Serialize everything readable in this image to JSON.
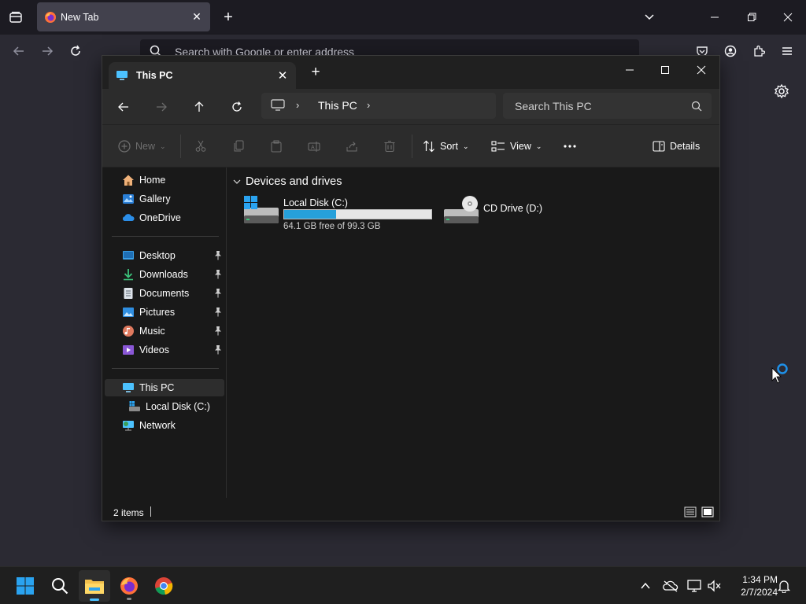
{
  "browser": {
    "tab_title": "New Tab",
    "url_placeholder": "Search with Google or enter address"
  },
  "explorer": {
    "tab_title": "This PC",
    "breadcrumb": "This PC",
    "search_placeholder": "Search This PC",
    "commands": {
      "new": "New",
      "sort": "Sort",
      "view": "View",
      "details": "Details"
    },
    "nav": {
      "home": "Home",
      "gallery": "Gallery",
      "onedrive": "OneDrive",
      "desktop": "Desktop",
      "downloads": "Downloads",
      "documents": "Documents",
      "pictures": "Pictures",
      "music": "Music",
      "videos": "Videos",
      "this_pc": "This PC",
      "local_disk": "Local Disk (C:)",
      "network": "Network"
    },
    "section_title": "Devices and drives",
    "drives": [
      {
        "name": "Local Disk (C:)",
        "free_text": "64.1 GB free of 99.3 GB",
        "used_fraction": 0.355
      },
      {
        "name": "CD Drive (D:)"
      }
    ],
    "status": "2 items"
  },
  "taskbar": {
    "time": "1:34 PM",
    "date": "2/7/2024"
  },
  "colors": {
    "accent": "#4cc2ff",
    "drive_bar": "#26a0da",
    "browser_bg": "#2b2a33"
  }
}
